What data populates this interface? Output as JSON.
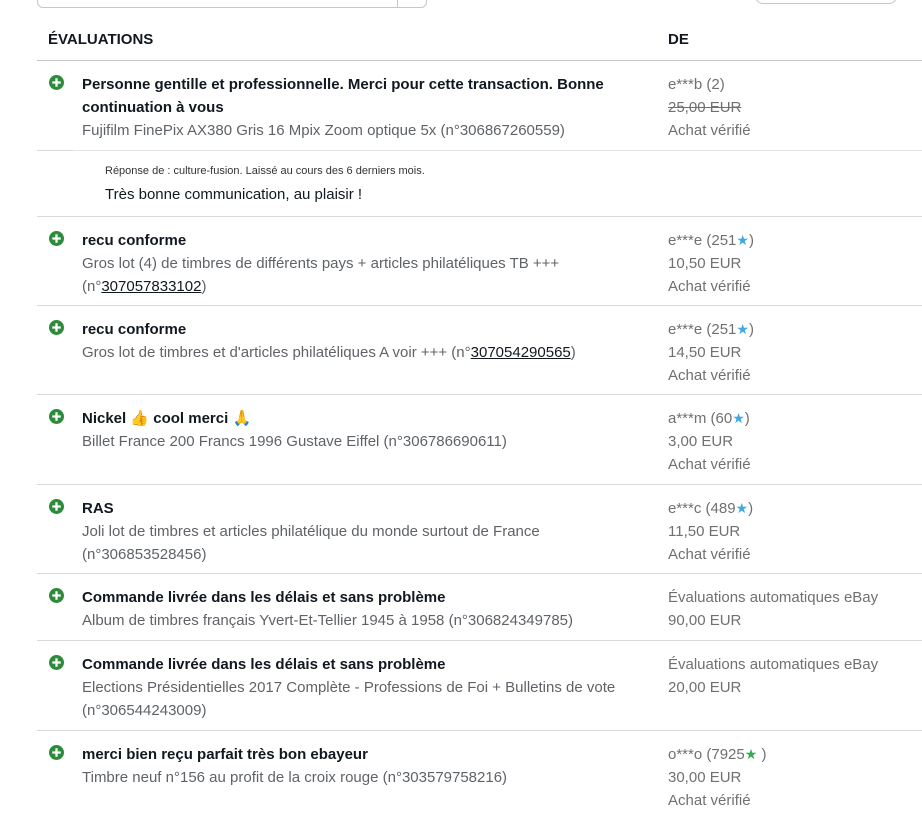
{
  "header": {
    "col_feedback": "ÉVALUATIONS",
    "col_from": "DE"
  },
  "colors": {
    "positive": "#2e8b3c",
    "star_blue": "#3fa9e0",
    "star_green": "#3aa851"
  },
  "rows": [
    {
      "comment": "Personne gentille et professionnelle. Merci pour cette transaction. Bonne continuation à vous",
      "item": "Fujifilm FinePix AX380 Gris 16 Mpix Zoom optique 5x (n°306867260559)",
      "user": "e***b (2)",
      "price": "25,00 EUR",
      "verified": "Achat vérifié",
      "reply_meta": "Réponse de : culture-fusion. Laissé au cours des 6 derniers mois.",
      "reply_text": "Très bonne communication, au plaisir !"
    },
    {
      "comment": "recu conforme",
      "item_prefix": "Gros lot (4) de timbres de différents pays + articles philatéliques TB +++ (n°",
      "item_link": "307057833102",
      "item_suffix": ")",
      "user_name": "e***e (251",
      "user_star": "★",
      "user_close": ")",
      "price": "10,50 EUR",
      "verified": "Achat vérifié"
    },
    {
      "comment": "recu conforme",
      "item_prefix": "Gros lot de timbres et d'articles philatéliques A voir +++ (n°",
      "item_link": "307054290565",
      "item_suffix": ")",
      "user_name": "e***e (251",
      "user_star": "★",
      "user_close": ")",
      "price": "14,50 EUR",
      "verified": "Achat vérifié"
    },
    {
      "comment_a": "Nickel ",
      "emoji_thumb": "👍",
      "comment_b": " cool merci ",
      "emoji_pray": "🙏",
      "item": "Billet France 200 Francs 1996 Gustave Eiffel (n°306786690611)",
      "user_name": "a***m (60",
      "user_star": "★",
      "user_close": ")",
      "price": "3,00 EUR",
      "verified": "Achat vérifié"
    },
    {
      "comment": "RAS",
      "item": "Joli lot de timbres et articles philatélique du monde surtout de France (n°306853528456)",
      "user_name": "e***c (489",
      "user_star": "★",
      "user_close": ")",
      "price": "11,50 EUR",
      "verified": "Achat vérifié"
    },
    {
      "comment": "Commande livrée dans les délais et sans problème",
      "item": "Album de timbres français Yvert-Et-Tellier 1945 à 1958 (n°306824349785)",
      "user": "Évaluations automatiques eBay",
      "price": "90,00 EUR"
    },
    {
      "comment": "Commande livrée dans les délais et sans problème",
      "item": "Elections Présidentielles 2017 Complète - Professions de Foi + Bulletins de vote (n°306544243009)",
      "user": "Évaluations automatiques eBay",
      "price": "20,00 EUR"
    },
    {
      "comment": "merci bien reçu parfait très bon ebayeur",
      "item": "Timbre neuf n°156 au profit de la croix rouge (n°303579758216)",
      "user_name": "o***o (7925",
      "user_star": "★",
      "user_close": " )",
      "price": "30,00 EUR",
      "verified": "Achat vérifié"
    }
  ]
}
